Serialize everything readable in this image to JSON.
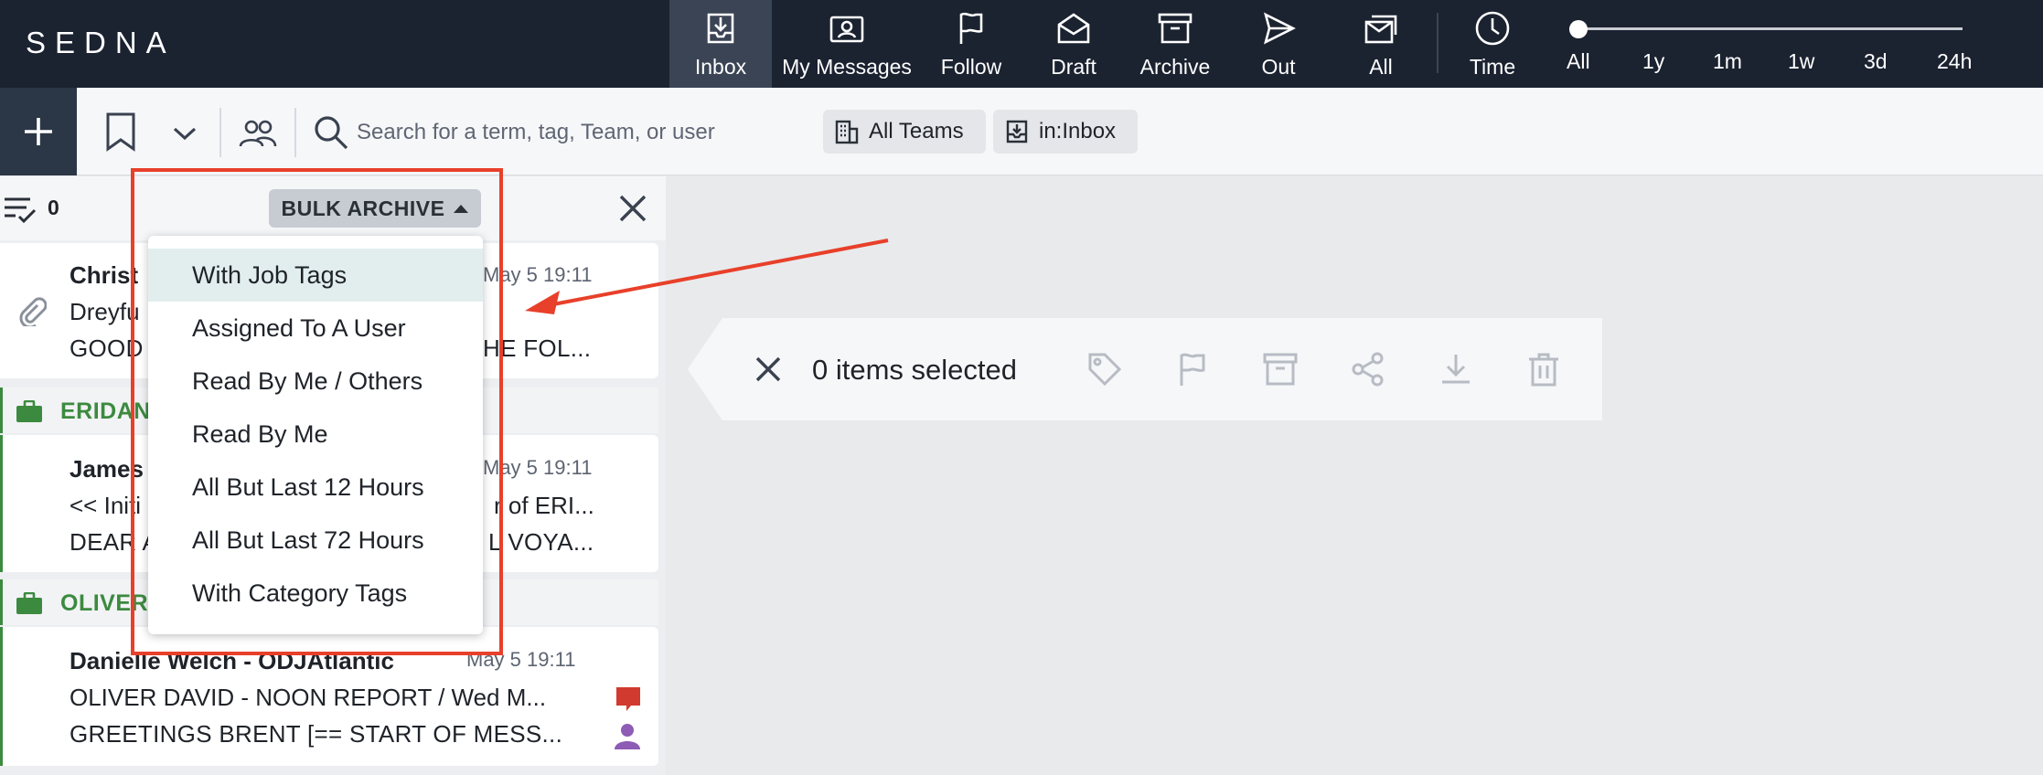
{
  "app": {
    "logo_text": "SEDNA"
  },
  "nav": {
    "items": [
      {
        "id": "inbox",
        "label": "Inbox",
        "icon": "inbox-icon",
        "active": true
      },
      {
        "id": "my-messages",
        "label": "My Messages",
        "icon": "id-card-icon"
      },
      {
        "id": "follow",
        "label": "Follow",
        "icon": "flag-icon"
      },
      {
        "id": "draft",
        "label": "Draft",
        "icon": "envelope-open-icon"
      },
      {
        "id": "archive",
        "label": "Archive",
        "icon": "archive-box-icon"
      },
      {
        "id": "out",
        "label": "Out",
        "icon": "paper-plane-icon"
      },
      {
        "id": "all",
        "label": "All",
        "icon": "envelopes-icon"
      },
      {
        "id": "time",
        "label": "Time",
        "icon": "clock-icon"
      }
    ],
    "time_ranges": [
      "All",
      "1y",
      "1m",
      "1w",
      "3d",
      "24h"
    ],
    "time_selected": "All"
  },
  "toolbar": {
    "search_placeholder": "Search for a term, tag, Team, or user",
    "chips": [
      {
        "label": "All Teams",
        "icon": "building-icon"
      },
      {
        "label": "in:Inbox",
        "icon": "inbox-icon"
      }
    ]
  },
  "list": {
    "selected_count": "0",
    "bulk_button_label": "BULK ARCHIVE",
    "messages": [
      {
        "from": "Christ",
        "subject": "Dreyfu",
        "preview": "GOOD",
        "preview_tail": "HE FOL...",
        "date": "May 5 19:11",
        "attachment": true
      }
    ],
    "groups": [
      {
        "name": "ERIDAN",
        "message": {
          "from": "James",
          "subject": "<< Initi",
          "subject_tail": "r of ERI...",
          "preview": "DEAR A",
          "preview_tail": "L VOYA...",
          "date": "May 5 19:11"
        }
      },
      {
        "name": "OLIVER",
        "message": {
          "from": "Danielle Welch - ODJAtlantic",
          "subject": "OLIVER DAVID - NOON REPORT / Wed M...",
          "preview": "GREETINGS BRENT [== START OF MESS...",
          "date": "May 5 19:11",
          "comment_color": "#d03a2f",
          "user_color": "#8e5bb5"
        }
      }
    ]
  },
  "dropdown": {
    "items": [
      "With Job Tags",
      "Assigned To A User",
      "Read By Me / Others",
      "Read By Me",
      "All But Last 12 Hours",
      "All But Last 72 Hours",
      "With Category Tags"
    ],
    "highlighted": "With Job Tags"
  },
  "selection_bar": {
    "text": "0 items selected",
    "actions": [
      "tag-icon",
      "flag-icon",
      "archive-box-icon",
      "share-icon",
      "download-icon",
      "trash-icon"
    ]
  },
  "annotation": {
    "color": "#e8402a"
  },
  "colors": {
    "nav_bg": "#1b2230",
    "team_green": "#3c8a3f",
    "highlight": "#e2eeee"
  }
}
